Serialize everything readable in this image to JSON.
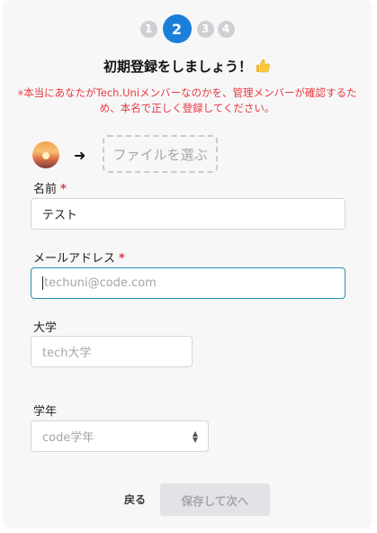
{
  "steps": [
    {
      "label": "1",
      "active": false
    },
    {
      "label": "2",
      "active": true
    },
    {
      "label": "3",
      "active": false
    },
    {
      "label": "4",
      "active": false
    }
  ],
  "title": "初期登録をしましょう！",
  "notice": {
    "mark": "※",
    "text": "本当にあなたがTech.Uniメンバーなのかを、管理メンバーが確認するため、本名で正しく登録してください。"
  },
  "file_button_label": "ファイルを選ぶ",
  "fields": {
    "name": {
      "label": "名前",
      "required_mark": "*",
      "value": "テスト"
    },
    "email": {
      "label": "メールアドレス",
      "required_mark": "*",
      "placeholder": "techuni@code.com"
    },
    "university": {
      "label": "大学",
      "placeholder": "tech大学"
    },
    "grade": {
      "label": "学年",
      "selected": "code学年"
    }
  },
  "buttons": {
    "back": "戻る",
    "save": "保存して次へ"
  },
  "colors": {
    "accent": "#1a7fd8",
    "required": "#e8383d",
    "focus_border": "#2a8fb0"
  }
}
